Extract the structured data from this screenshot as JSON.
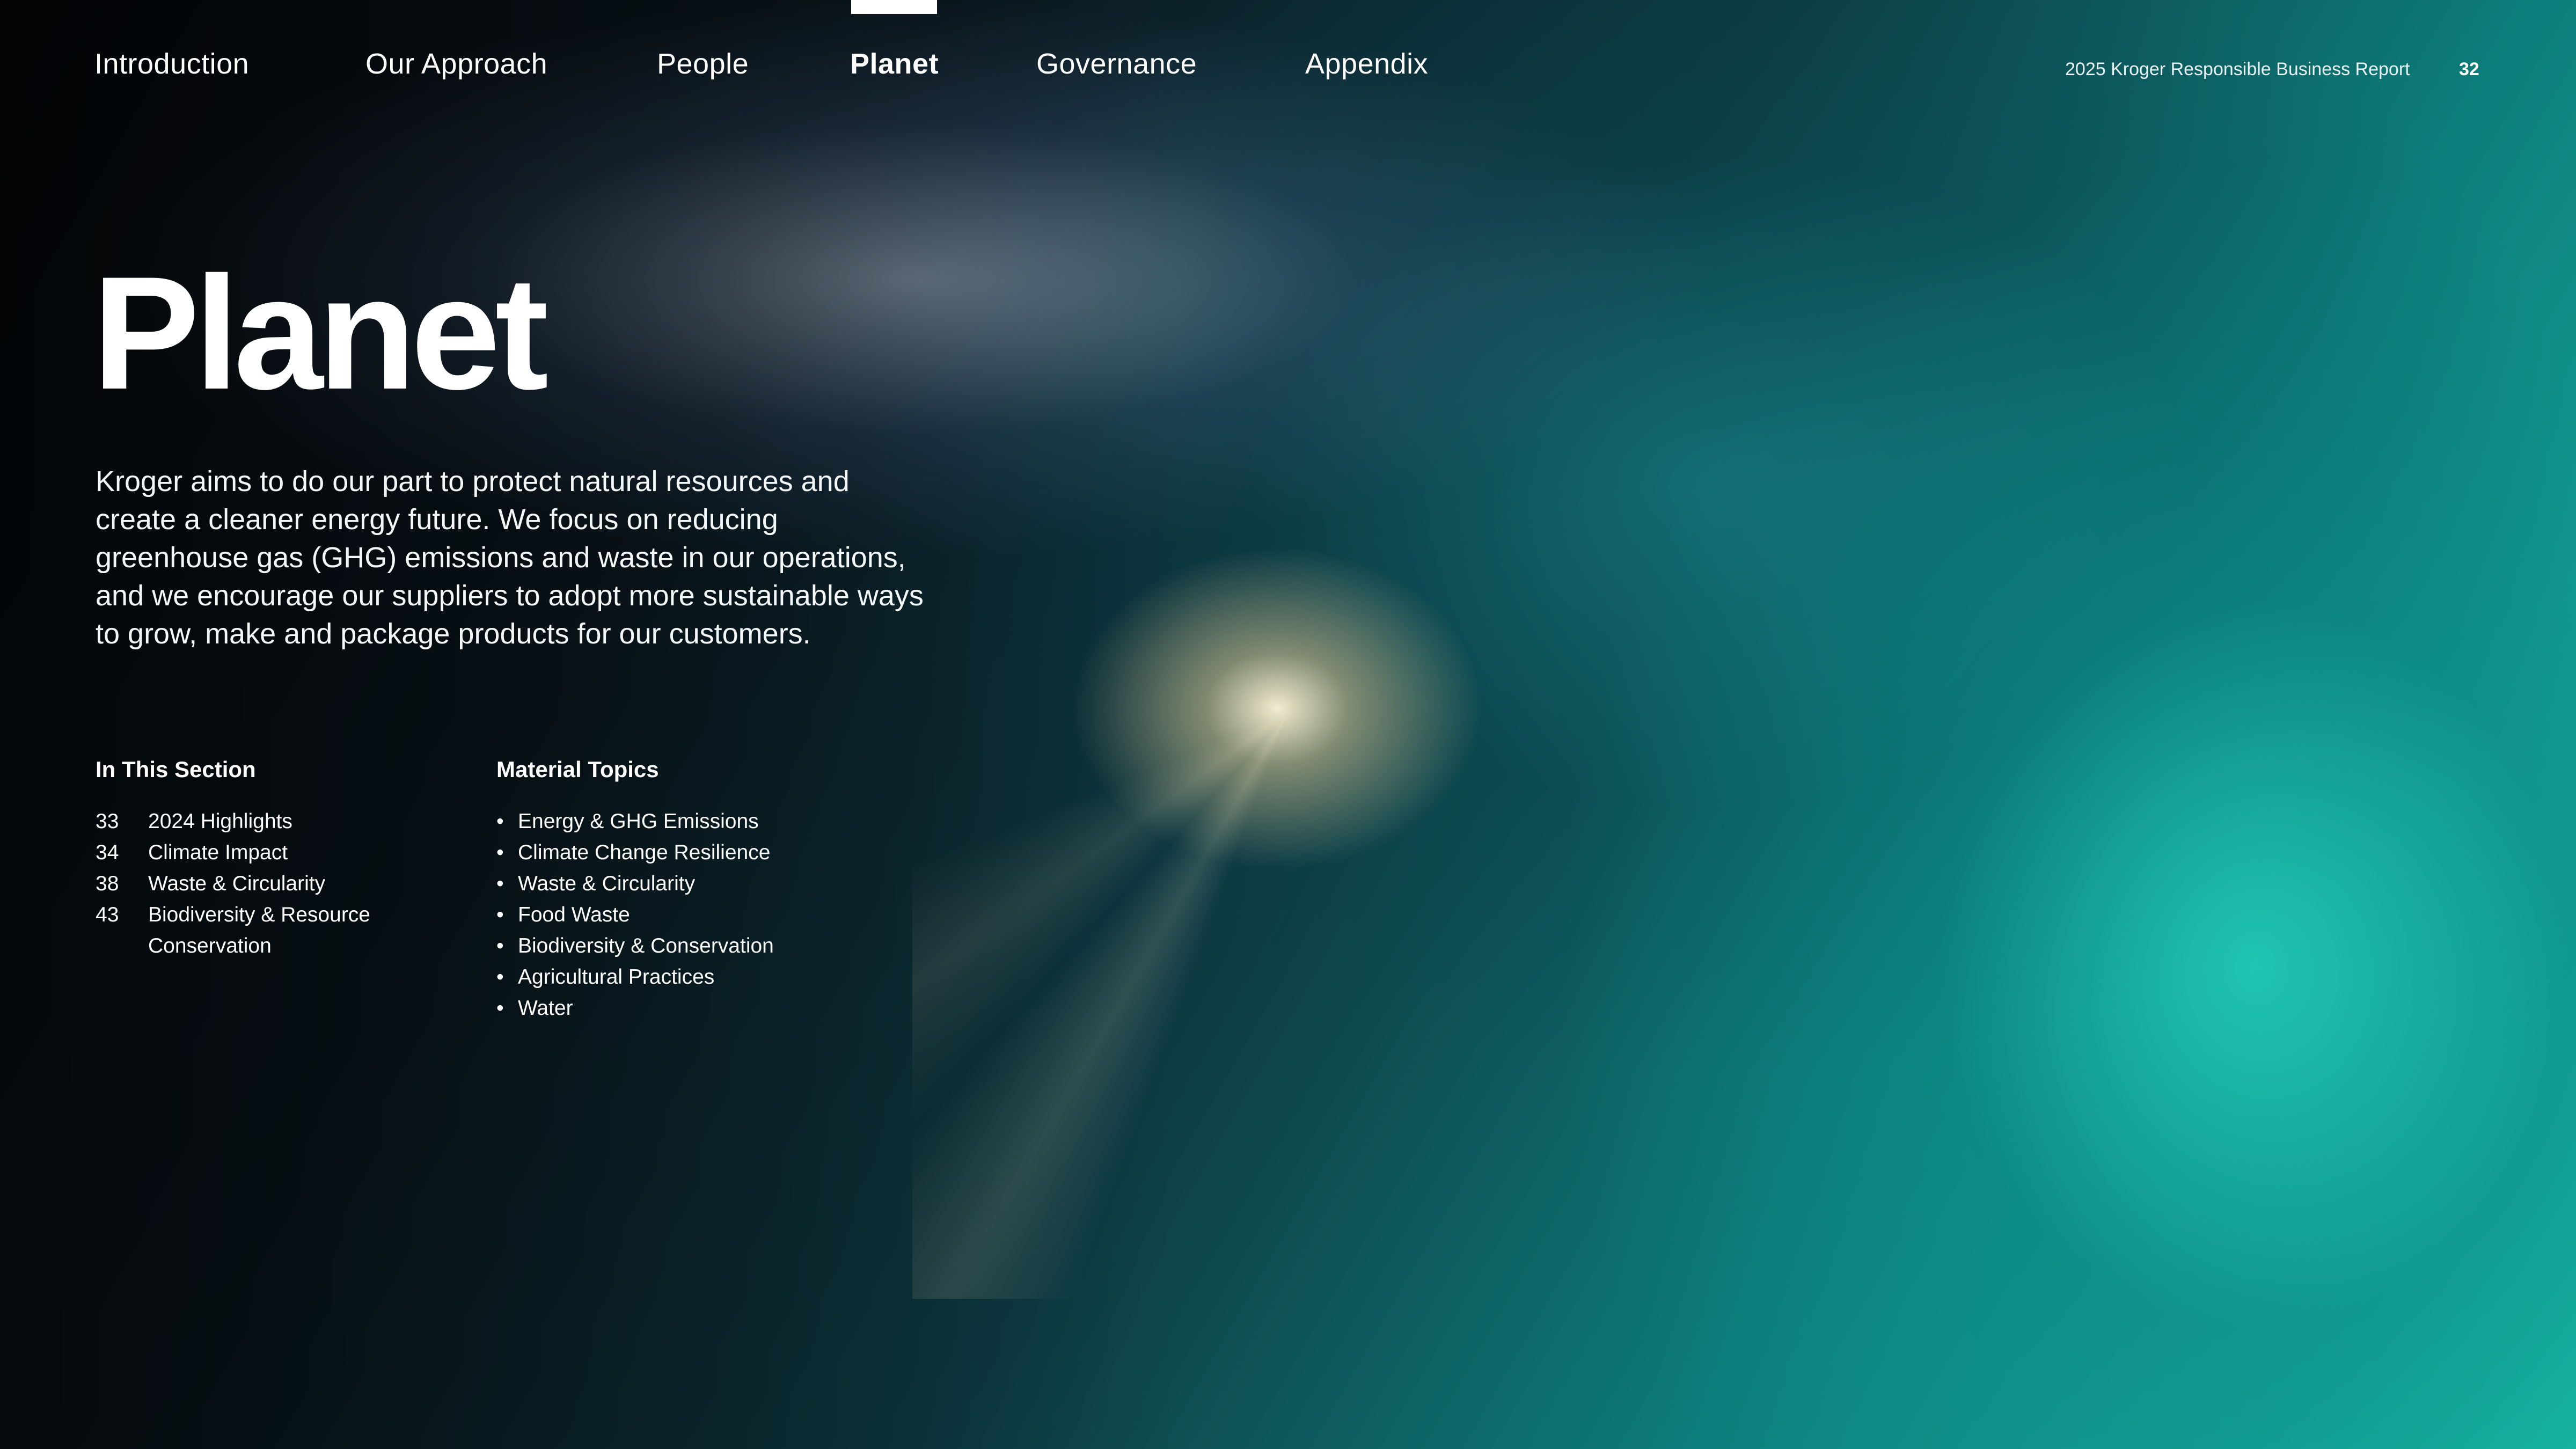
{
  "nav": {
    "items": [
      {
        "label": "Introduction"
      },
      {
        "label": "Our Approach"
      },
      {
        "label": "People"
      },
      {
        "label": "Planet"
      },
      {
        "label": "Governance"
      },
      {
        "label": "Appendix"
      }
    ],
    "active": "Planet"
  },
  "header": {
    "report_title": "2025 Kroger Responsible Business Report",
    "page_number": "32"
  },
  "hero": {
    "title": "Planet",
    "intro": "Kroger aims to do our part to protect natural resources and create a cleaner energy future. We focus on reducing greenhouse gas (GHG) emissions and waste in our operations, and we encourage our suppliers to adopt more sustainable ways to grow, make and package products for our customers."
  },
  "in_this_section": {
    "title": "In This Section",
    "items": [
      {
        "page": "33",
        "label": "2024 Highlights"
      },
      {
        "page": "34",
        "label": "Climate Impact"
      },
      {
        "page": "38",
        "label": "Waste & Circularity"
      },
      {
        "page": "43",
        "label": "Biodiversity & Resource Conservation"
      }
    ]
  },
  "material_topics": {
    "title": "Material Topics",
    "bullet": "•",
    "items": [
      "Energy & GHG Emissions",
      "Climate Change Resilience",
      "Waste & Circularity",
      "Food Waste",
      "Biodiversity & Conservation",
      "Agricultural Practices",
      "Water"
    ]
  }
}
